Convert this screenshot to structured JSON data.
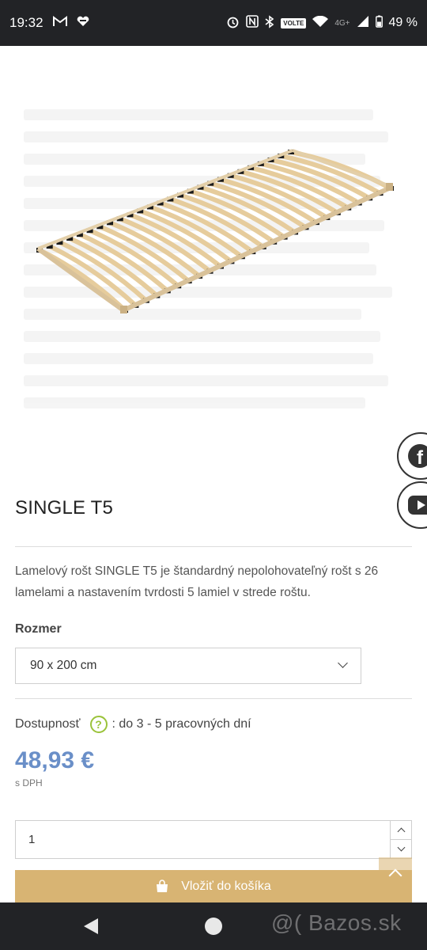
{
  "status_bar": {
    "time": "19:32",
    "battery": "49 %",
    "volte": "VOLTE",
    "network": "4G+",
    "icons": [
      "gmail-icon",
      "heart-app-icon",
      "alarm-icon",
      "nfc-icon",
      "bluetooth-icon",
      "wifi-icon",
      "signal-icon",
      "battery-icon"
    ]
  },
  "product": {
    "title": "SINGLE T5",
    "description": "Lamelový rošt SINGLE T5 je štandardný nepolohovateľný rošt s 26 lamelami a nastavením tvrdosti 5 lamiel v strede roštu.",
    "size_label": "Rozmer",
    "size_value": "90 x 200 cm",
    "availability_label": "Dostupnosť",
    "availability_value": ": do 3 - 5 pracovných dní",
    "help_glyph": "?",
    "price": "48,93 €",
    "price_note": "s DPH",
    "quantity": "1",
    "add_to_cart": "Vložiť do košíka"
  },
  "social": {
    "facebook_glyph": "f"
  },
  "watermark": "@( Bazos.sk",
  "colors": {
    "price": "#6a8fc8",
    "cart_button": "#d8b473",
    "help_icon": "#9bc33b",
    "system_bars": "#222326"
  }
}
